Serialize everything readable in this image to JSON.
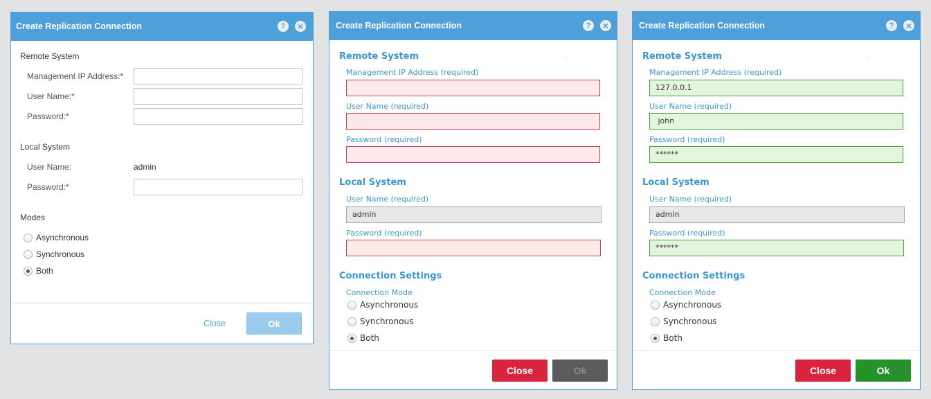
{
  "dialog1": {
    "title": "Create Replication Connection",
    "remote_section": "Remote System",
    "mgmt_ip_label": "Management IP Address:",
    "username_label": "User Name:",
    "password_label": "Password:",
    "required_mark": "*",
    "local_section": "Local System",
    "local_username_label": "User Name:",
    "local_username_value": "admin",
    "local_password_label": "Password:",
    "modes_section": "Modes",
    "mode_async": "Asynchronous",
    "mode_sync": "Synchronous",
    "mode_both": "Both",
    "selected_mode": "Both",
    "close_label": "Close",
    "ok_label": "Ok"
  },
  "dialog2": {
    "title": "Create Replication Connection",
    "remote_section": "Remote System",
    "mgmt_ip_label": "Management IP Address (required)",
    "mgmt_ip_value": "",
    "username_label": "User Name (required)",
    "username_value": "",
    "password_label": "Password (required)",
    "password_value": "",
    "local_section": "Local System",
    "local_username_label": "User Name (required)",
    "local_username_value": "admin",
    "local_password_label": "Password (required)",
    "local_password_value": "",
    "conn_section": "Connection Settings",
    "conn_mode_label": "Connection Mode",
    "mode_async": "Asynchronous",
    "mode_sync": "Synchronous",
    "mode_both": "Both",
    "selected_mode": "Both",
    "close_label": "Close",
    "ok_label": "Ok",
    "ok_enabled": false
  },
  "dialog3": {
    "title": "Create Replication Connection",
    "remote_section": "Remote System",
    "mgmt_ip_label": "Management IP Address (required)",
    "mgmt_ip_value": "127.0.0.1",
    "username_label": "User Name (required)",
    "username_value": " john",
    "password_label": "Password (required)",
    "password_value": "******",
    "local_section": "Local System",
    "local_username_label": "User Name (required)",
    "local_username_value": "admin",
    "local_password_label": "Password (required)",
    "local_password_value": "******",
    "conn_section": "Connection Settings",
    "conn_mode_label": "Connection Mode",
    "mode_async": "Asynchronous",
    "mode_sync": "Synchronous",
    "mode_both": "Both",
    "selected_mode": "Both",
    "close_label": "Close",
    "ok_label": "Ok",
    "ok_enabled": true
  },
  "icons": {
    "help": "?",
    "close": "×"
  },
  "colors": {
    "header_blue": "#4fa0da",
    "label_blue": "#3c95d2",
    "required_red": "#d9232e",
    "error_bg": "#fde9ea",
    "error_border": "#c94055",
    "valid_bg": "#e3f5dd",
    "valid_border": "#4aa13a",
    "close_button": "#d9233f",
    "ok_button": "#27922b",
    "ok_disabled": "#5b5b5b"
  }
}
